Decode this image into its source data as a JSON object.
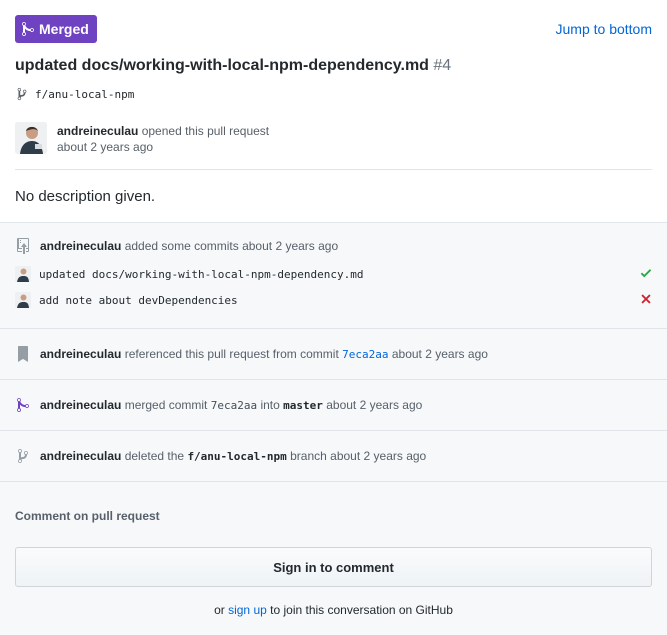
{
  "header": {
    "badge_label": "Merged",
    "jump_label": "Jump to bottom",
    "title": "updated docs/working-with-local-npm-dependency.md",
    "number": "#4",
    "branch": "f/anu-local-npm",
    "opener_user": "andreineculau",
    "opener_action": "opened this pull request",
    "opener_time": "about 2 years ago",
    "description": "No description given."
  },
  "timeline": {
    "commits_event": {
      "user": "andreineculau",
      "text": "added some commits about 2 years ago",
      "commits": [
        {
          "message": "updated docs/working-with-local-npm-dependency.md",
          "status": "success",
          "status_icon": "check-icon"
        },
        {
          "message": "add note about devDependencies",
          "status": "failure",
          "status_icon": "x-icon"
        }
      ]
    },
    "reference_event": {
      "user": "andreineculau",
      "text": "referenced this pull request from commit",
      "sha": "7eca2aa",
      "time": "about 2 years ago"
    },
    "merge_event": {
      "user": "andreineculau",
      "text": "merged commit",
      "sha": "7eca2aa",
      "into": "into",
      "target": "master",
      "time": "about 2 years ago"
    },
    "delete_event": {
      "user": "andreineculau",
      "text": "deleted the",
      "branch": "f/anu-local-npm",
      "suffix": "branch about 2 years ago"
    }
  },
  "comment": {
    "heading": "Comment on pull request",
    "signin_label": "Sign in to comment",
    "join_prefix": "or",
    "signup_label": "sign up",
    "join_suffix": "to join this conversation on GitHub"
  },
  "colors": {
    "merged_purple": "#6f42c1",
    "link_blue": "#0366d6",
    "success_green": "#28a745",
    "failure_red": "#cb2431"
  }
}
